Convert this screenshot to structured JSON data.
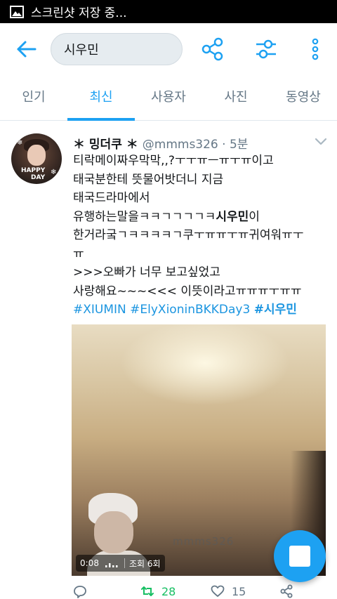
{
  "status_bar": {
    "text": "스크린샷 저장 중..."
  },
  "search": {
    "query": "시우민"
  },
  "tabs": [
    {
      "label": "인기"
    },
    {
      "label": "최신",
      "active": true
    },
    {
      "label": "사용자"
    },
    {
      "label": "사진"
    },
    {
      "label": "동영상"
    }
  ],
  "tweet": {
    "display_name": "＊ 밍더쿠 ＊",
    "handle": "@mmms326 · 5분",
    "avatar_badge_line1": "HAPPY",
    "avatar_badge_line2": "DAY",
    "lines": {
      "l1": "티락메이짜우막막,,?ㅜㅜㅠㅡㅠㅜㅠ이고",
      "l2": "태국분한테 뜻물어밧더니 지금",
      "l3": "태국드라마에서",
      "l4_pre": "유행하는말을ㅋㅋㄱㄱㄱㄱㅋ",
      "l4_bold": "시우민",
      "l4_post": "이",
      "l5": "한거라궄ㄱㅋㅋㅋㅋㄱ쿠ㅜㅠㅠㅜㅠ귀여워ㅠㅜ",
      "l6": "ㅠ",
      "l7": ">>>오빠가 너무 보고싶었고",
      "l8": "사랑해요~~~<<< 이뜻이라고ㅠㅠㅠㅜㅠㅠ"
    },
    "hashtags": [
      "#XIUMIN",
      "#ElyXioninBKKDay3",
      "#시우민"
    ],
    "media": {
      "watermark": "mmms326",
      "duration": "0:08",
      "views": "조회 6회"
    },
    "retweet_count": "28",
    "like_count": "15"
  },
  "colors": {
    "accent": "#1da1f2",
    "retweet": "#17bf63",
    "muted": "#657786"
  }
}
